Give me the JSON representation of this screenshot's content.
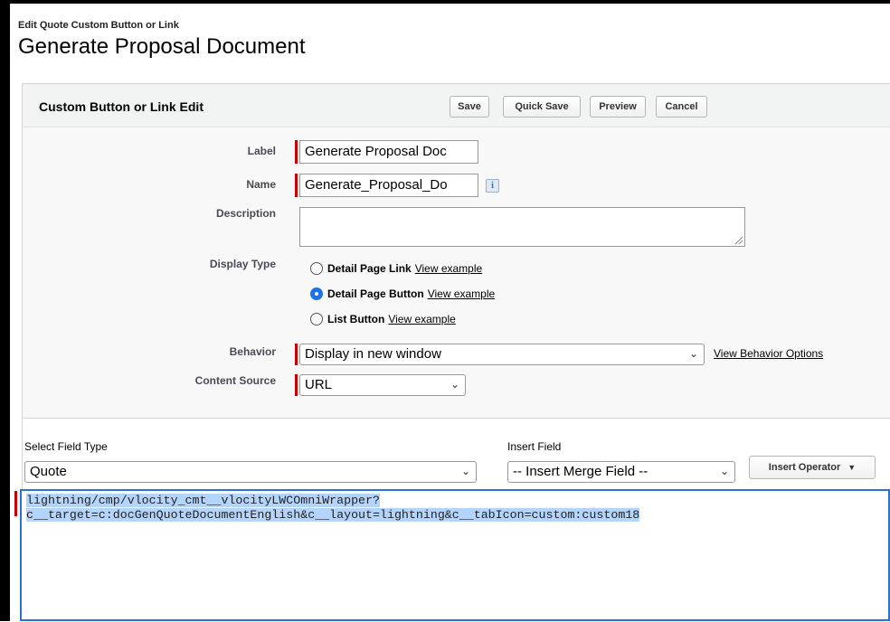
{
  "page": {
    "subtitle": "Edit Quote Custom Button or Link",
    "title": "Generate Proposal Document"
  },
  "panel": {
    "title": "Custom Button or Link Edit",
    "buttons": {
      "save": "Save",
      "quick_save": "Quick Save",
      "preview": "Preview",
      "cancel": "Cancel"
    }
  },
  "form": {
    "label": {
      "label": "Label",
      "value": "Generate Proposal Doc"
    },
    "name": {
      "label": "Name",
      "value": "Generate_Proposal_Do",
      "info_icon": "i"
    },
    "description": {
      "label": "Description",
      "value": ""
    },
    "display_type": {
      "label": "Display Type",
      "options": [
        {
          "label": "Detail Page Link",
          "link": "View example",
          "selected": false
        },
        {
          "label": "Detail Page Button",
          "link": "View example",
          "selected": true
        },
        {
          "label": "List Button",
          "link": "View example",
          "selected": false
        }
      ]
    },
    "behavior": {
      "label": "Behavior",
      "value": "Display in new window",
      "options_link": "View Behavior Options"
    },
    "content_source": {
      "label": "Content Source",
      "value": "URL"
    }
  },
  "formula": {
    "select_field_type_label": "Select Field Type",
    "select_field_type_value": "Quote",
    "insert_field_label": "Insert Field",
    "insert_field_value": "-- Insert Merge Field --",
    "insert_operator": "Insert Operator",
    "code_line1": "lightning/cmp/vlocity_cmt__vlocityLWCOmniWrapper?",
    "code_line2": "c__target=c:docGenQuoteDocumentEnglish&c__layout=lightning&c__tabIcon=custom:custom18"
  },
  "colors": {
    "required": "#cc0000",
    "focus_border": "#2a74d1",
    "selection": "#b3d4fc",
    "radio_selected": "#1a73e8"
  }
}
